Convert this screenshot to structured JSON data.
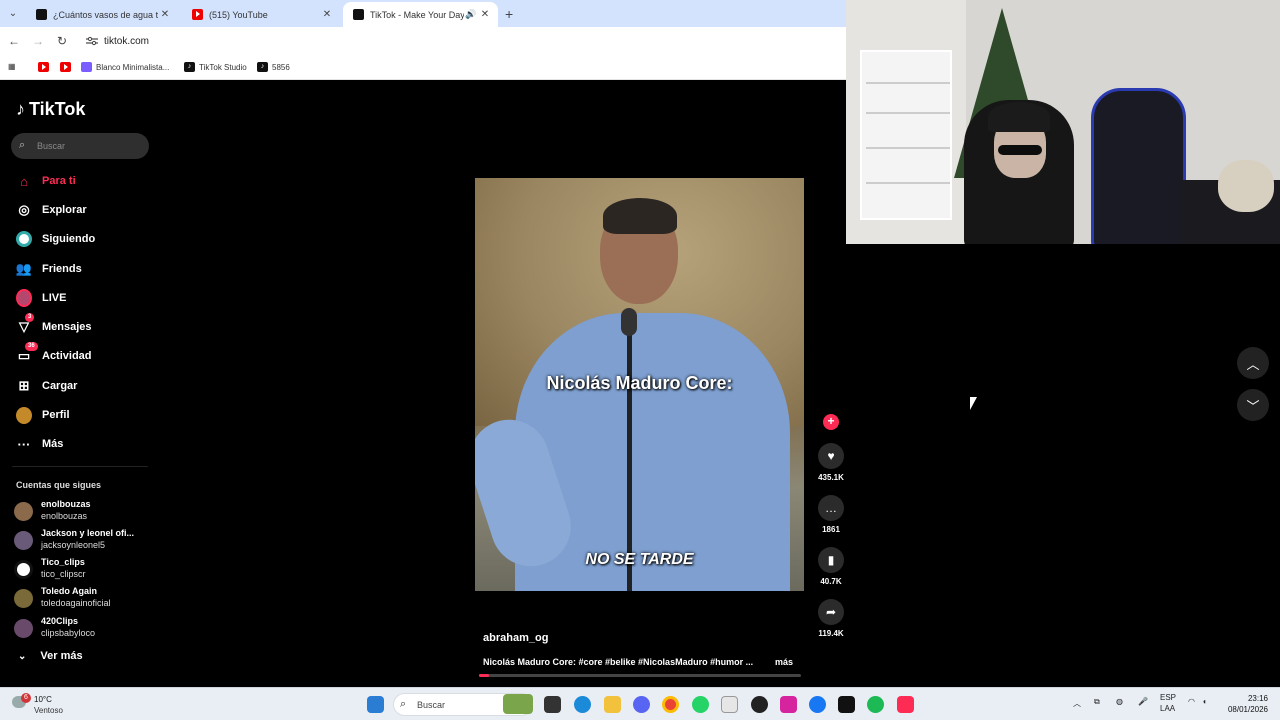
{
  "browser": {
    "tabs": [
      {
        "title": "¿Cuántos vasos de agua te llev",
        "active": false
      },
      {
        "title": "(515) YouTube",
        "active": false
      },
      {
        "title": "TikTok - Make Your Day",
        "active": true
      }
    ],
    "url": "tiktok.com",
    "bookmarks": [
      "Blanco Minimalista...",
      "TikTok Studio",
      "5856"
    ]
  },
  "tiktok": {
    "logo": "TikTok",
    "search_placeholder": "Buscar",
    "nav": [
      {
        "label": "Para ti",
        "icon": "home-icon",
        "active": true
      },
      {
        "label": "Explorar",
        "icon": "compass-icon"
      },
      {
        "label": "Siguiendo",
        "icon": "following-icon"
      },
      {
        "label": "Friends",
        "icon": "friends-icon"
      },
      {
        "label": "LIVE",
        "icon": "live-icon"
      },
      {
        "label": "Mensajes",
        "icon": "messages-icon",
        "badge": "3"
      },
      {
        "label": "Actividad",
        "icon": "activity-icon",
        "badge": "36"
      },
      {
        "label": "Cargar",
        "icon": "upload-icon"
      },
      {
        "label": "Perfil",
        "icon": "profile-icon"
      },
      {
        "label": "Más",
        "icon": "more-icon"
      }
    ],
    "following_title": "Cuentas que sigues",
    "following": [
      {
        "name": "enolbouzas",
        "handle": "enolbouzas"
      },
      {
        "name": "Jackson y leonel ofi...",
        "handle": "jacksoynleonel5"
      },
      {
        "name": "Tico_clips",
        "handle": "tico_clipscr"
      },
      {
        "name": "Toledo Again",
        "handle": "toledoagainoficial"
      },
      {
        "name": "420Clips",
        "handle": "clipsbabyloco"
      }
    ],
    "see_more": "Ver más",
    "video": {
      "caption_top": "Nicolás Maduro Core:",
      "caption_bottom": "NO SE TARDE",
      "author": "abraham_og",
      "description": "Nicolás Maduro Core: #core #belike #NicolasMaduro #humor ...",
      "more": "más",
      "progress": 0.03
    },
    "actions": {
      "likes": "435.1K",
      "comments": "1861",
      "saves": "40.7K",
      "shares": "119.4K"
    }
  },
  "taskbar": {
    "temp": "10°C",
    "condition": "Ventoso",
    "weather_badge": "6",
    "search_placeholder": "Buscar",
    "lang1": "ESP",
    "lang2": "LAA",
    "time": "23:16",
    "date": "08/01/2026"
  },
  "colors": {
    "tiktok_accent": "#fe2c55",
    "background": "#000000"
  }
}
